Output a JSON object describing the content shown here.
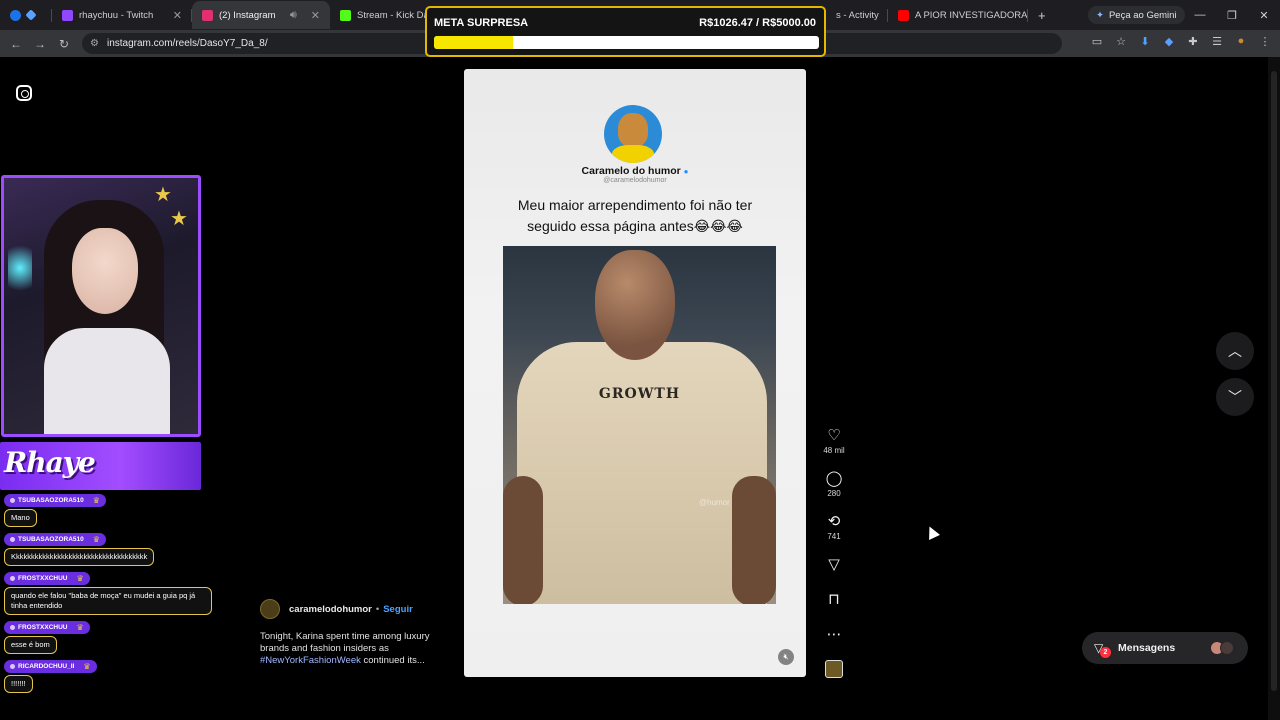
{
  "tabs": [
    {
      "label": "",
      "color": "#1a73e8",
      "active": false
    },
    {
      "label": "rhaychuu - Twitch",
      "color": "#9146ff",
      "active": false
    },
    {
      "label": "(2) Instagram",
      "color": "#e1306c",
      "active": true
    },
    {
      "label": "Stream - Kick Dash",
      "color": "#53fc18",
      "active": false
    },
    {
      "label": "s - Activity",
      "color": "#5865f2",
      "active": false
    },
    {
      "label": "A PIOR INVESTIGADORA",
      "color": "#ff0000",
      "active": false
    }
  ],
  "browser": {
    "url": "instagram.com/reels/DasoY7_Da_8/",
    "gemini_label": "Peça ao Gemini",
    "new_tab": "+"
  },
  "goal": {
    "title": "META SURPRESA",
    "amount": "R$1026.47 / R$5000.00",
    "progress_fraction": 0.205
  },
  "reel": {
    "account_name": "Caramelo do humor",
    "account_handle": "@caramelodohumor",
    "caption": "Meu maior arrependimento foi não ter seguido essa página antes😂😂😂",
    "video_text": "GROWTH",
    "video_watermark": "@humor"
  },
  "actions": {
    "likes": "48 mil",
    "comments": "280",
    "reposts": "741"
  },
  "post": {
    "username": "caramelodohumor",
    "separator": "•",
    "follow_label": "Seguir",
    "description_before": "Tonight, Karina spent time among luxury brands and fashion insiders as ",
    "hashtag": "#NewYorkFashionWeek",
    "description_after": " continued its..."
  },
  "messages": {
    "label": "Mensagens",
    "badge": "2"
  },
  "overlay": {
    "banner_text": "Rhaye"
  },
  "chat": [
    {
      "user": "TSUBASAOZORA510",
      "text": "Mano"
    },
    {
      "user": "TSUBASAOZORA510",
      "text": "Kkkkkkkkkkkkkkkkkkkkkkkkkkkkkkkkkkkk"
    },
    {
      "user": "FROSTXXCHUU",
      "text": "quando ele falou \"baba de moça\" eu mudei a guia pq já tinha entendido"
    },
    {
      "user": "FROSTXXCHUU",
      "text": "esse é bom"
    },
    {
      "user": "RICARDOCHUU_II",
      "text": "!!!!!!!"
    }
  ],
  "colors": {
    "accent_purple": "#9b4dff",
    "goal_border": "#e3b800",
    "goal_fill": "#f7e600",
    "follow_blue": "#4aa3ff"
  }
}
